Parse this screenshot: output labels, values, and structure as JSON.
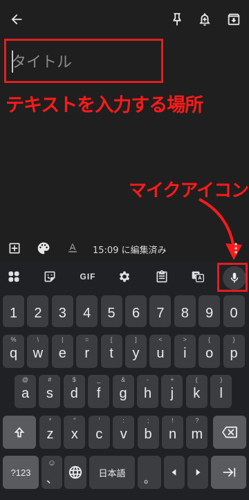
{
  "title_placeholder": "タイトル",
  "annotations": {
    "input_area": "テキストを入力する場所",
    "mic_icon": "マイクアイコン"
  },
  "note_bar": {
    "edited_label": "15:09 に編集済み"
  },
  "keyboard": {
    "toolbar": {
      "gif_label": "GIF"
    },
    "row1": [
      "1",
      "2",
      "3",
      "4",
      "5",
      "6",
      "7",
      "8",
      "9",
      "0"
    ],
    "row2": [
      {
        "k": "q",
        "h": "%"
      },
      {
        "k": "w",
        "h": "\\"
      },
      {
        "k": "e",
        "h": "|"
      },
      {
        "k": "r",
        "h": "="
      },
      {
        "k": "t",
        "h": "["
      },
      {
        "k": "y",
        "h": "]"
      },
      {
        "k": "u",
        "h": "<"
      },
      {
        "k": "i",
        "h": ">"
      },
      {
        "k": "o",
        "h": "{"
      },
      {
        "k": "p",
        "h": "}"
      }
    ],
    "row3": [
      {
        "k": "a",
        "h": "@"
      },
      {
        "k": "s",
        "h": "#"
      },
      {
        "k": "d",
        "h": "$"
      },
      {
        "k": "f",
        "h": "_"
      },
      {
        "k": "g",
        "h": "&"
      },
      {
        "k": "h",
        "h": "-"
      },
      {
        "k": "j",
        "h": "+"
      },
      {
        "k": "k",
        "h": "("
      },
      {
        "k": "l",
        "h": ")"
      }
    ],
    "row4": [
      {
        "k": "z",
        "h": "*"
      },
      {
        "k": "x",
        "h": "\""
      },
      {
        "k": "c",
        "h": "'"
      },
      {
        "k": "v",
        "h": ":"
      },
      {
        "k": "b",
        "h": ";"
      },
      {
        "k": "n",
        "h": "!"
      },
      {
        "k": "m",
        "h": "?"
      }
    ],
    "sym_label": "?123",
    "emoji_hint": "☺",
    "emoji_main": "、",
    "space_label": "日本語",
    "period_label": "。"
  },
  "colors": {
    "annotation": "#e02020",
    "key": "#3c3d40",
    "background": "#1f1f1f"
  }
}
